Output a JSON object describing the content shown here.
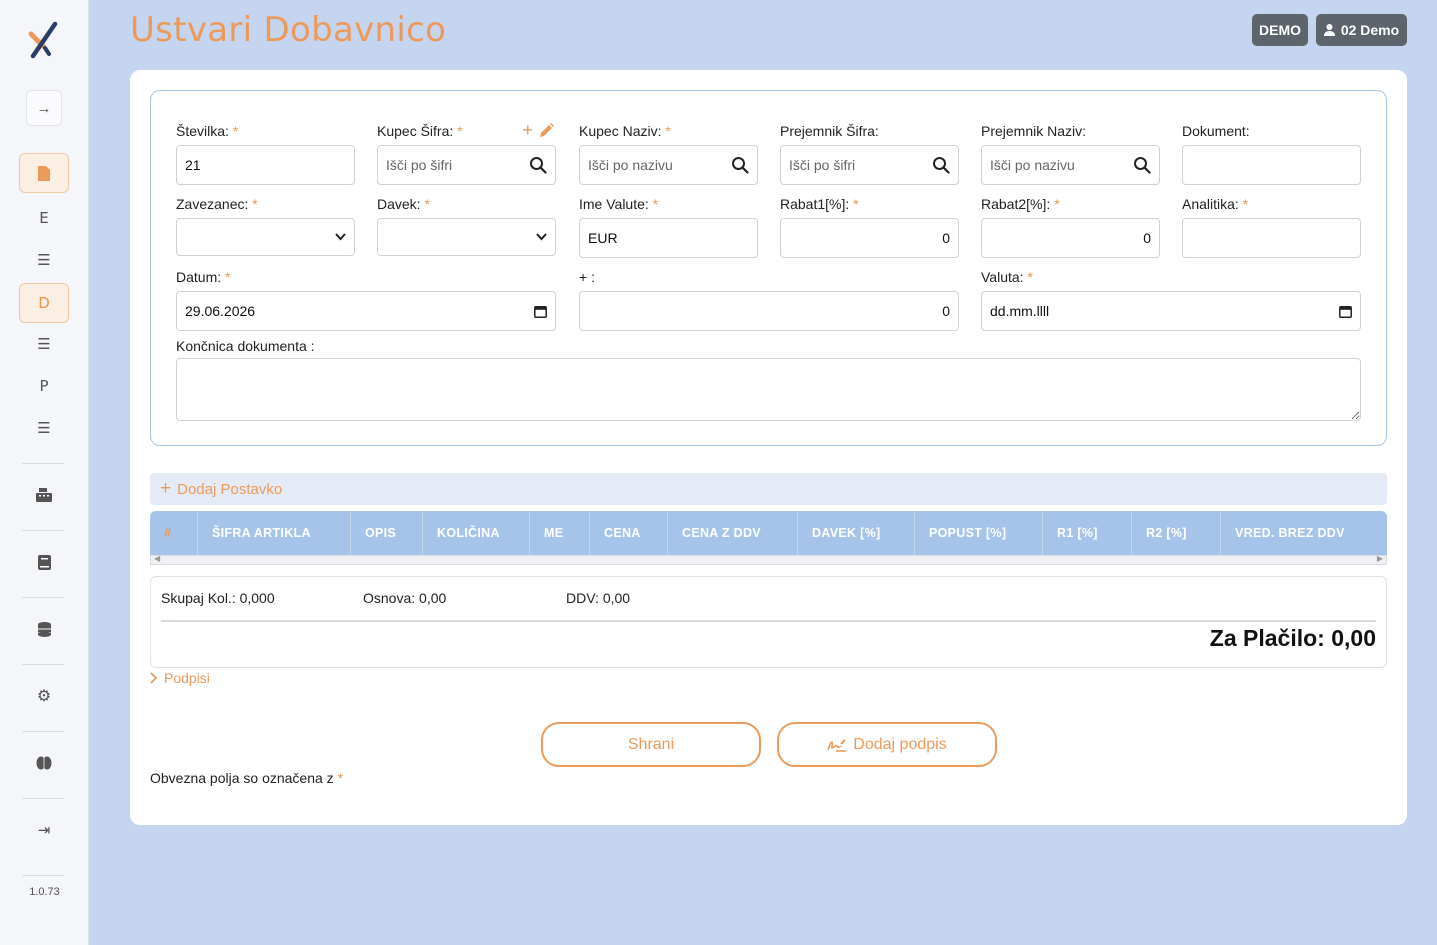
{
  "sidebar": {
    "letters": {
      "e": "E",
      "d": "D",
      "p": "P"
    },
    "version": "1.0.73"
  },
  "header": {
    "title": "Ustvari Dobavnico",
    "demo_label": "DEMO",
    "user_label": "02 Demo"
  },
  "form": {
    "stevilka": {
      "label": "Številka:",
      "value": "21"
    },
    "kupec_sifra": {
      "label": "Kupec Šifra:",
      "placeholder": "Išči po šifri"
    },
    "kupec_naziv": {
      "label": "Kupec Naziv:",
      "placeholder": "Išči po nazivu"
    },
    "prejemnik_sifra": {
      "label": "Prejemnik Šifra:",
      "placeholder": "Išči po šifri"
    },
    "prejemnik_naziv": {
      "label": "Prejemnik Naziv:",
      "placeholder": "Išči po nazivu"
    },
    "dokument": {
      "label": "Dokument:",
      "value": ""
    },
    "zavezanec": {
      "label": "Zavezanec:",
      "value": ""
    },
    "davek": {
      "label": "Davek:",
      "value": ""
    },
    "ime_valute": {
      "label": "Ime Valute:",
      "value": "EUR"
    },
    "rabat1": {
      "label": "Rabat1[%]:",
      "value": "0"
    },
    "rabat2": {
      "label": "Rabat2[%]:",
      "value": "0"
    },
    "analitika": {
      "label": "Analitika:",
      "value": ""
    },
    "datum": {
      "label": "Datum:",
      "value": "29.06.2026"
    },
    "plus": {
      "label": "+ :",
      "value": "0"
    },
    "valuta": {
      "label": "Valuta:",
      "value": "dd.mm.llll"
    },
    "koncnica": {
      "label": "Končnica dokumenta :"
    },
    "required_mark": "*"
  },
  "items": {
    "add_label": "Dodaj Postavko",
    "columns": [
      "#",
      "Šifra artikla",
      "Opis",
      "Količina",
      "ME",
      "Cena",
      "Cena z DDV",
      "Davek [%]",
      "Popust [%]",
      "R1 [%]",
      "R2 [%]",
      "Vred. brez DDV"
    ]
  },
  "totals": {
    "kol": "Skupaj Kol.: 0,000",
    "osnova": "Osnova: 0,00",
    "ddv": "DDV: 0,00",
    "za_placilo": "Za Plačilo: 0,00"
  },
  "podpisi": "Podpisi",
  "actions": {
    "save": "Shrani",
    "add_signature": "Dodaj podpis"
  },
  "note": {
    "text": "Obvezna polja so označena z",
    "mark": "*"
  },
  "colors": {
    "accent": "#ec9a5a",
    "table_header": "#a6c4ea",
    "background": "#c5d5ef"
  }
}
